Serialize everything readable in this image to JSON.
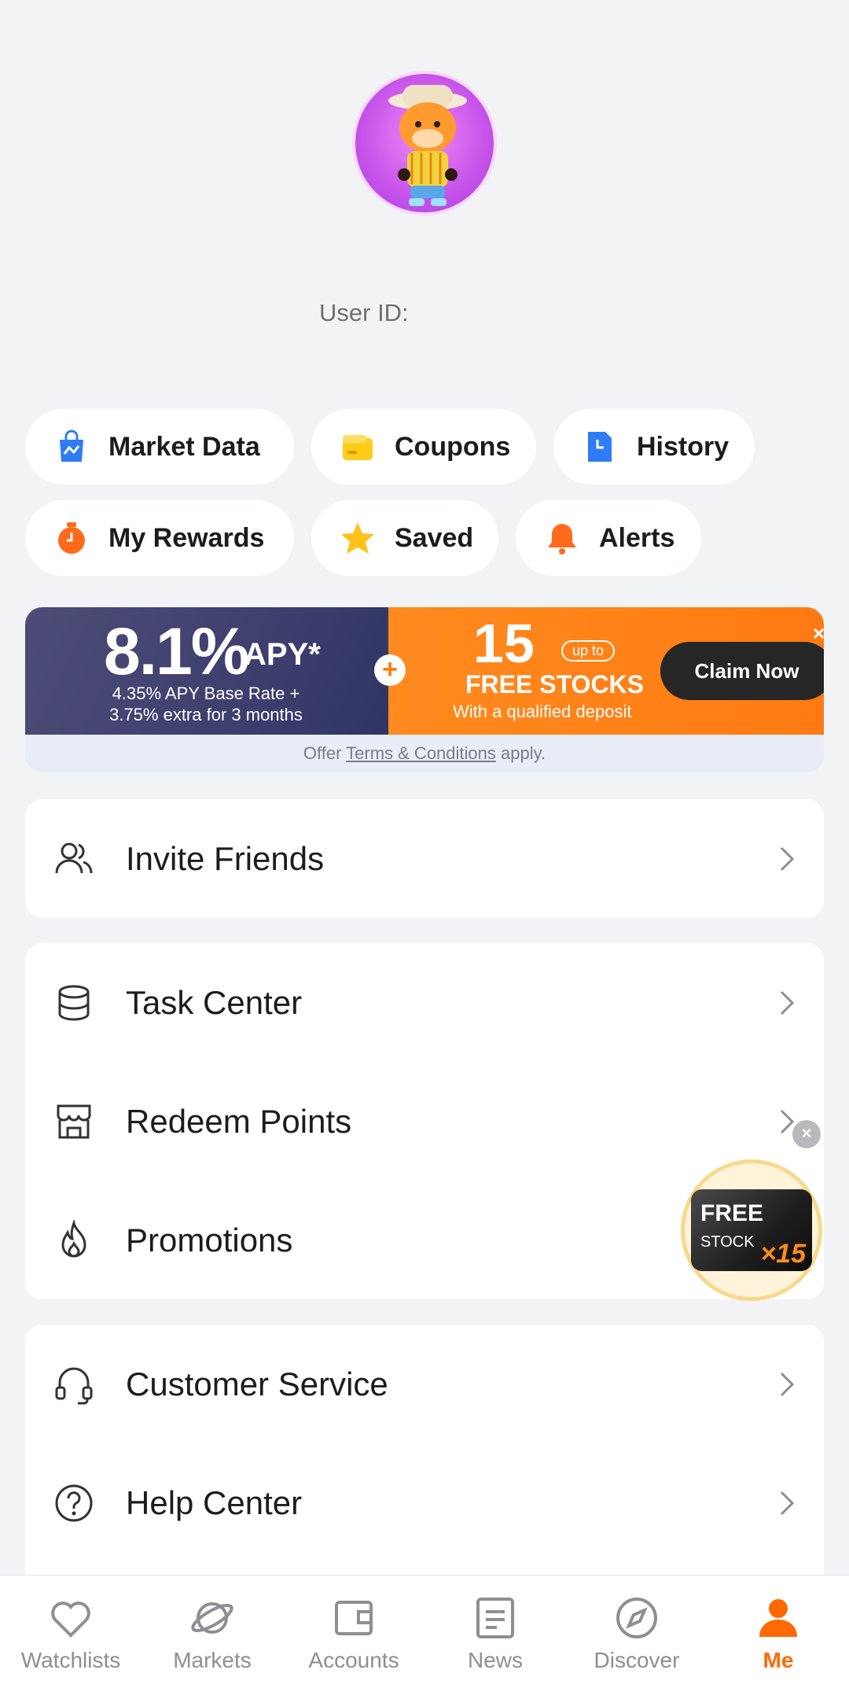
{
  "profile": {
    "user_id_label": "User ID:"
  },
  "quick_actions": [
    {
      "label": "Market Data",
      "icon": "market-data-bag-icon"
    },
    {
      "label": "Coupons",
      "icon": "coupon-wallet-icon"
    },
    {
      "label": "History",
      "icon": "history-document-icon"
    },
    {
      "label": "My Rewards",
      "icon": "rewards-timer-icon"
    },
    {
      "label": "Saved",
      "icon": "star-icon"
    },
    {
      "label": "Alerts",
      "icon": "bell-icon"
    }
  ],
  "banner": {
    "apy_value": "8.1%",
    "apy_unit": "APY*",
    "apy_sub_line1": "4.35% APY Base Rate +",
    "apy_sub_line2": "3.75% extra for 3 months",
    "plus": "+",
    "stocks_count": "15",
    "up_to": "up to",
    "free_stocks": "FREE STOCKS",
    "qualified": "With a qualified deposit",
    "claim_label": "Claim Now",
    "close": "×",
    "terms_prefix": "Offer ",
    "terms_link": "Terms & Conditions",
    "terms_suffix": " apply."
  },
  "menu_groups": [
    {
      "items": [
        {
          "label": "Invite Friends",
          "icon": "invite-friends-icon"
        }
      ]
    },
    {
      "items": [
        {
          "label": "Task Center",
          "icon": "task-center-icon"
        },
        {
          "label": "Redeem Points",
          "icon": "store-icon"
        },
        {
          "label": "Promotions",
          "icon": "flame-icon"
        }
      ]
    },
    {
      "items": [
        {
          "label": "Customer Service",
          "icon": "headset-icon"
        },
        {
          "label": "Help Center",
          "icon": "help-circle-icon"
        }
      ]
    }
  ],
  "promo_bubble": {
    "free": "FREE",
    "stock": "STOCK",
    "count": "×15",
    "close": "×"
  },
  "tabbar": [
    {
      "label": "Watchlists",
      "icon": "heart-icon",
      "active": false
    },
    {
      "label": "Markets",
      "icon": "planet-icon",
      "active": false
    },
    {
      "label": "Accounts",
      "icon": "wallet-icon",
      "active": false
    },
    {
      "label": "News",
      "icon": "news-icon",
      "active": false
    },
    {
      "label": "Discover",
      "icon": "compass-icon",
      "active": false
    },
    {
      "label": "Me",
      "icon": "person-icon",
      "active": true
    }
  ],
  "colors": {
    "accent": "#ff6a00",
    "background": "#f2f3f5",
    "banner_dark": "#3f3f6e",
    "banner_orange": "#ff7a12"
  }
}
